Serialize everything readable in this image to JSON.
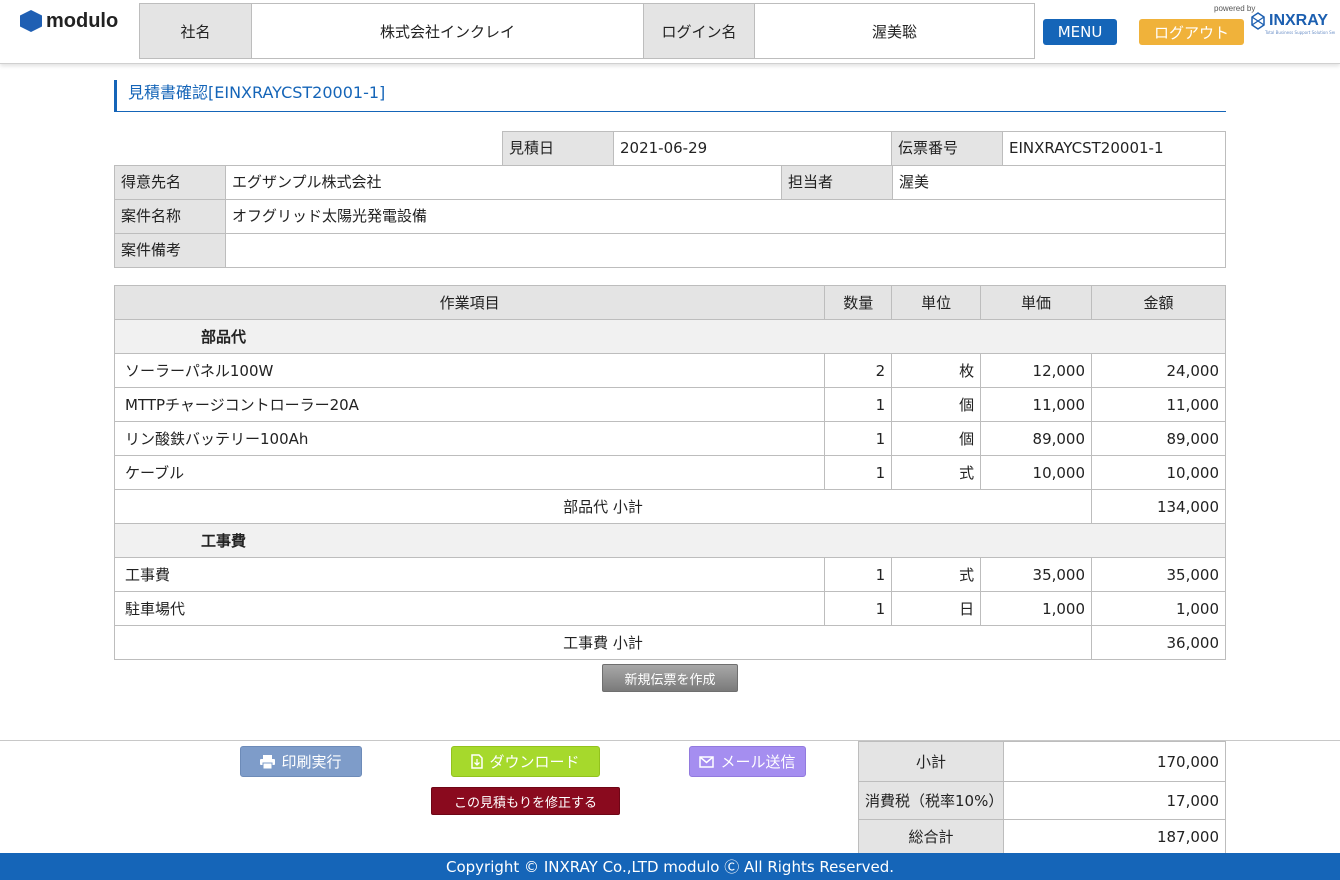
{
  "header": {
    "logo_text": "modulo",
    "company_label": "社名",
    "company_value": "株式会社インクレイ",
    "login_label": "ログイン名",
    "login_value": "渥美聡",
    "menu_label": "MENU",
    "logout_label": "ログアウト",
    "powered_by": "powered by",
    "brand": "INXRAY",
    "brand_tagline": "Total Business Support Solution Service"
  },
  "page": {
    "title": "見積書確認[EINXRAYCST20001-1]"
  },
  "info": {
    "date_label": "見積日",
    "date_value": "2021-06-29",
    "slip_label": "伝票番号",
    "slip_value": "EINXRAYCST20001-1",
    "customer_label": "得意先名",
    "customer_value": "エグザンプル株式会社",
    "staff_label": "担当者",
    "staff_value": "渥美",
    "project_label": "案件名称",
    "project_value": "オフグリッド太陽光発電設備",
    "notes_label": "案件備考",
    "notes_value": ""
  },
  "items": {
    "headers": [
      "作業項目",
      "数量",
      "単位",
      "単価",
      "金額"
    ],
    "sections": [
      {
        "title": "部品代",
        "rows": [
          {
            "name": "ソーラーパネル100W",
            "qty": "2",
            "unit": "枚",
            "price": "12,000",
            "amount": "24,000"
          },
          {
            "name": "MTTPチャージコントローラー20A",
            "qty": "1",
            "unit": "個",
            "price": "11,000",
            "amount": "11,000"
          },
          {
            "name": "リン酸鉄バッテリー100Ah",
            "qty": "1",
            "unit": "個",
            "price": "89,000",
            "amount": "89,000"
          },
          {
            "name": "ケーブル",
            "qty": "1",
            "unit": "式",
            "price": "10,000",
            "amount": "10,000"
          }
        ],
        "subtotal_label": "部品代 小計",
        "subtotal_value": "134,000"
      },
      {
        "title": "工事費",
        "rows": [
          {
            "name": "工事費",
            "qty": "1",
            "unit": "式",
            "price": "35,000",
            "amount": "35,000"
          },
          {
            "name": "駐車場代",
            "qty": "1",
            "unit": "日",
            "price": "1,000",
            "amount": "1,000"
          }
        ],
        "subtotal_label": "工事費 小計",
        "subtotal_value": "36,000"
      }
    ]
  },
  "actions": {
    "new_slip": "新規伝票を作成",
    "print": "印刷実行",
    "download": "ダウンロード",
    "mail": "メール送信",
    "edit": "この見積もりを修正する"
  },
  "totals": {
    "subtotal_label": "小計",
    "subtotal_value": "170,000",
    "tax_label": "消費税（税率10%）",
    "tax_value": "17,000",
    "grand_label": "総合計",
    "grand_value": "187,000"
  },
  "footer": {
    "copyright": "Copyright © INXRAY Co.,LTD modulo Ⓒ All Rights Reserved."
  },
  "colors": {
    "primary": "#1565b8",
    "logout": "#f0b23a",
    "print": "#7e9cc9",
    "download": "#a6d92c",
    "mail": "#a58ef0",
    "edit": "#8a0a1e"
  },
  "icons": {
    "print": "printer-icon",
    "download": "file-download-icon",
    "mail": "envelope-icon"
  }
}
